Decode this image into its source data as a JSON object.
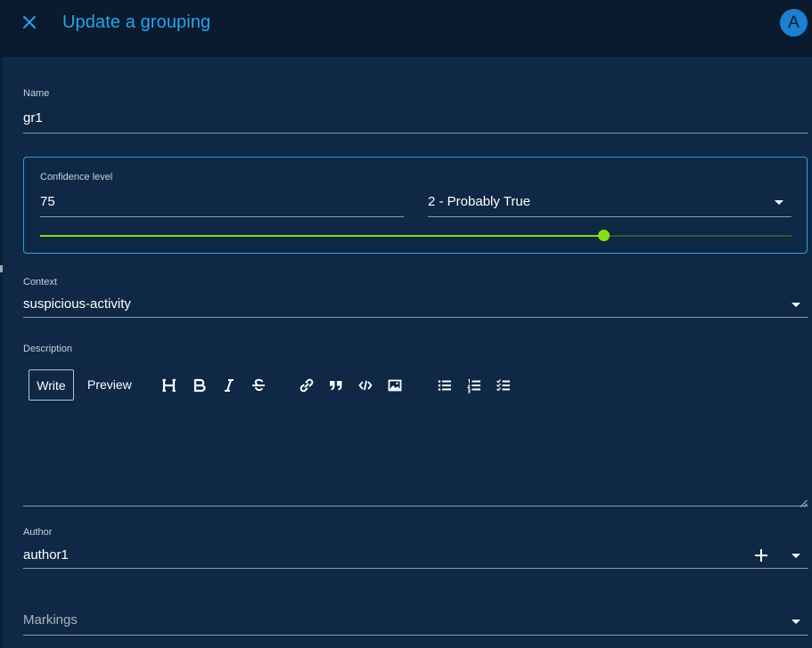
{
  "header": {
    "title": "Update a grouping",
    "close_icon": "close-icon",
    "avatar_letter": "A"
  },
  "form": {
    "name": {
      "label": "Name",
      "value": "gr1"
    },
    "confidence": {
      "label": "Confidence level",
      "value": "75",
      "level_selected": "2 - Probably True",
      "slider_value": 75,
      "slider_min": 0,
      "slider_max": 100
    },
    "context": {
      "label": "Context",
      "value": "suspicious-activity"
    },
    "description": {
      "label": "Description",
      "write_label": "Write",
      "preview_label": "Preview",
      "value": "",
      "toolbar_icons": [
        "heading-icon",
        "bold-icon",
        "italic-icon",
        "strikethrough-icon",
        "link-icon",
        "quote-icon",
        "code-icon",
        "image-icon",
        "bulleted-list-icon",
        "numbered-list-icon",
        "checklist-icon"
      ]
    },
    "author": {
      "label": "Author",
      "value": "author1"
    },
    "markings": {
      "placeholder": "Markings"
    }
  },
  "colors": {
    "background": "#0e2845",
    "header_background": "#0a1b30",
    "accent": "#27a3ec",
    "slider": "#84e014"
  }
}
